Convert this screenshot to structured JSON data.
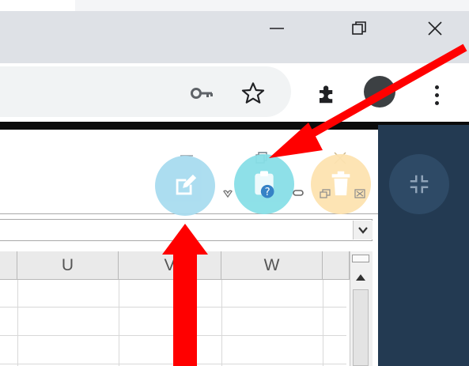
{
  "browser": {
    "window_controls": {
      "minimize": "minimize",
      "restore": "restore",
      "close": "close"
    },
    "toolbar_icons": [
      "key-icon",
      "star-icon",
      "extensions-icon",
      "profile-icon",
      "menu-icon"
    ]
  },
  "spreadsheet": {
    "columns": [
      "U",
      "V",
      "W"
    ]
  },
  "floating_toolbar": {
    "buttons": [
      "edit-icon",
      "help-icon",
      "trash-icon",
      "collapse-icon"
    ]
  },
  "colors": {
    "arrow": "#ff0000",
    "side_panel": "#233a52",
    "edit_circle": "#a6dbef",
    "help_circle": "#88dfe7",
    "trash_circle": "#fde3b0",
    "collapse_circle": "#2e4a66"
  }
}
